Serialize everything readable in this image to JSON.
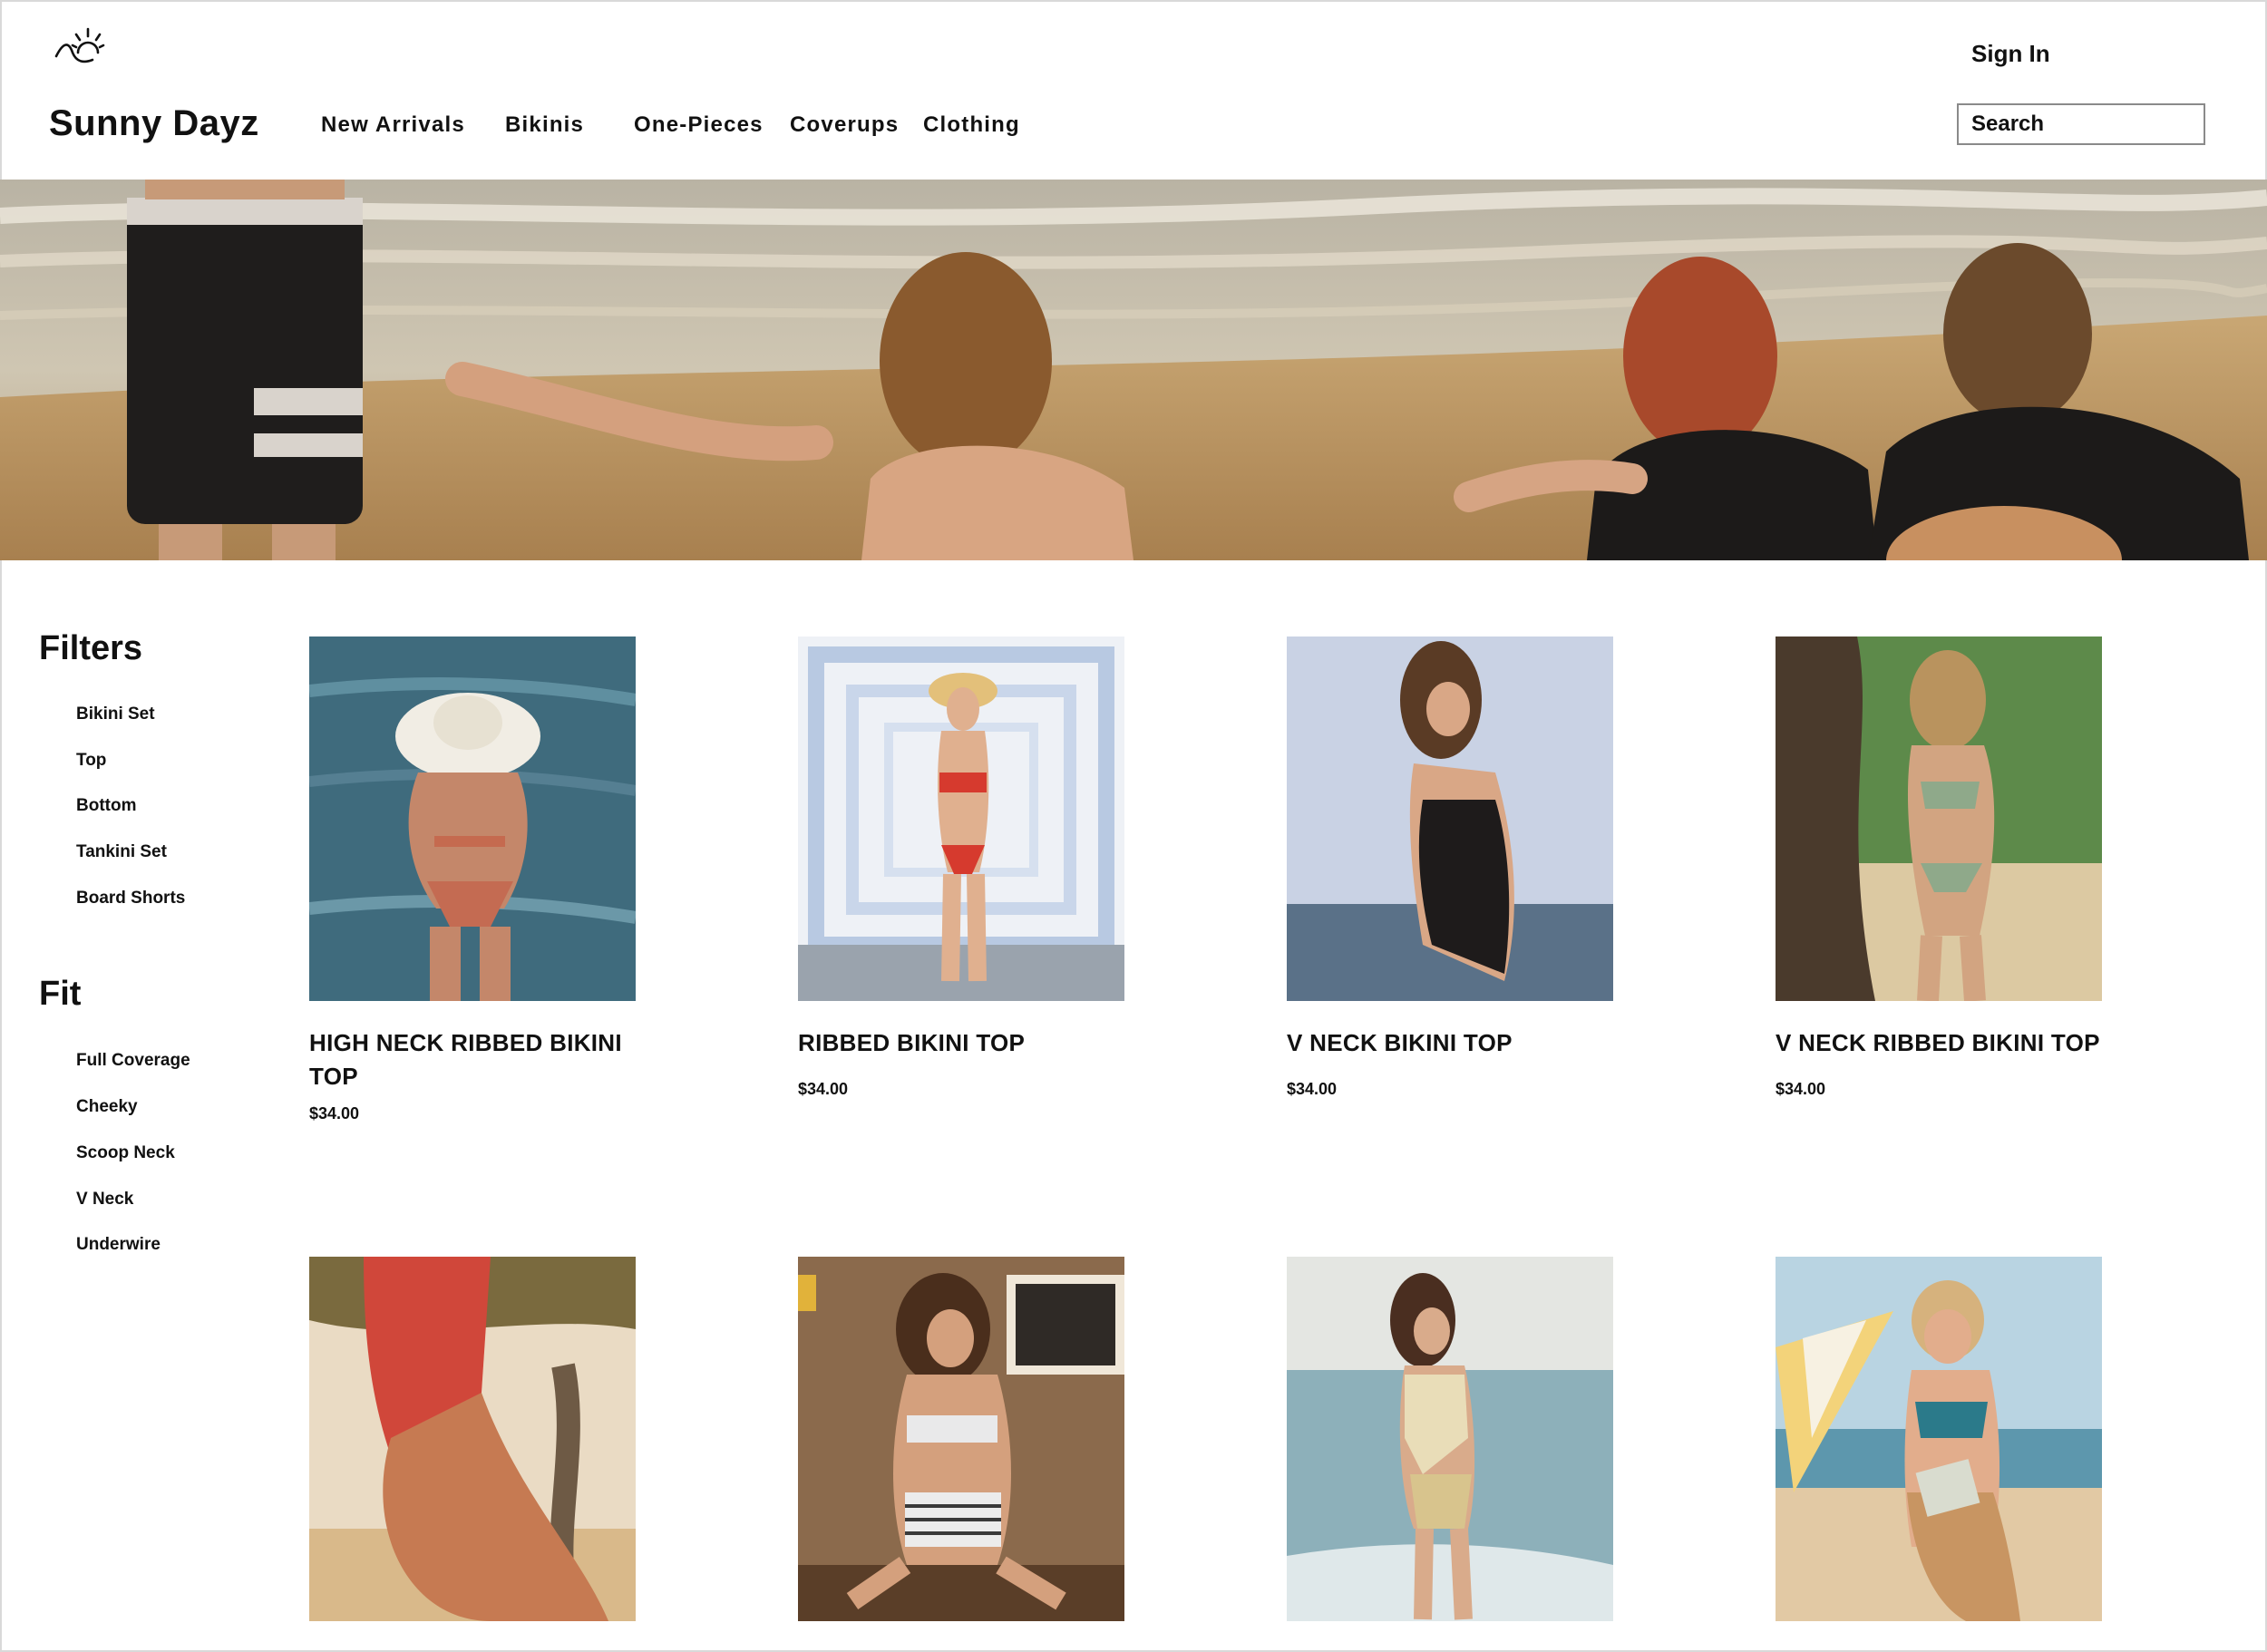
{
  "header": {
    "brand": "Sunny Dayz",
    "nav": [
      "New Arrivals",
      "Bikinis",
      "One-Pieces",
      "Coverups",
      "Clothing"
    ],
    "sign_in": "Sign In",
    "search_placeholder": "Search"
  },
  "sidebar": {
    "filters_heading": "Filters",
    "filters": [
      "Bikini Set",
      "Top",
      "Bottom",
      "Tankini Set",
      "Board Shorts"
    ],
    "fit_heading": "Fit",
    "fit": [
      "Full Coverage",
      "Cheeky",
      "Scoop Neck",
      "V Neck",
      "Underwire"
    ]
  },
  "products": [
    {
      "title": "HIGH NECK RIBBED BIKINI TOP",
      "price": "$34.00"
    },
    {
      "title": "RIBBED BIKINI TOP",
      "price": "$34.00"
    },
    {
      "title": "V NECK BIKINI TOP",
      "price": "$34.00"
    },
    {
      "title": "V NECK RIBBED BIKINI TOP",
      "price": "$34.00"
    }
  ],
  "colors": {
    "text": "#111111",
    "border": "#d9d9d9",
    "sand": "#c9a06e",
    "sea": "#5f8fa6"
  },
  "icons": {
    "logo": "sun-setting-icon"
  }
}
